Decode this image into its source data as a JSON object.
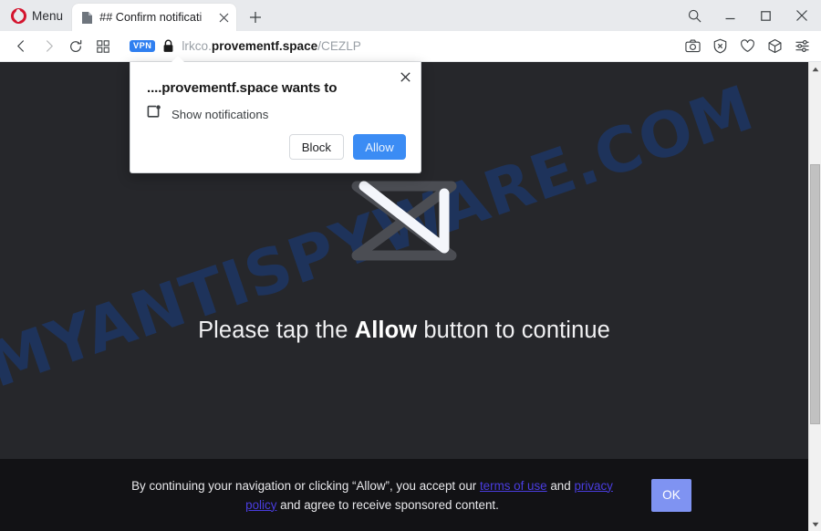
{
  "browser": {
    "menu_label": "Menu",
    "tab": {
      "title": "## Confirm notificati",
      "favicon_name": "page-favicon",
      "close_label": "×"
    },
    "new_tab_label": "+",
    "window_controls": {
      "search": "search-icon",
      "minimize": "minimize-icon",
      "maximize": "maximize-icon",
      "close": "close-icon"
    },
    "nav": {
      "back": "back-arrow-icon",
      "forward": "forward-arrow-icon",
      "reload": "reload-icon",
      "tab_gallery": "tab-gallery-icon"
    },
    "address": {
      "vpn_badge": "VPN",
      "lock_icon": "padlock-icon",
      "url_prefix": "lrkco.",
      "url_domain": "provementf.space",
      "url_path": "/CEZLP"
    },
    "toolbar_icons": [
      {
        "name": "snapshot-icon",
        "label": "Snapshot"
      },
      {
        "name": "ad-blocker-icon",
        "label": "Ad blocker"
      },
      {
        "name": "heart-icon",
        "label": "Add to favorites"
      },
      {
        "name": "crypto-wallet-icon",
        "label": "Crypto Wallet"
      },
      {
        "name": "easy-setup-icon",
        "label": "Easy setup"
      }
    ]
  },
  "permission_dialog": {
    "title": "....provementf.space wants to",
    "permission_icon": "notification-bell-icon",
    "permission_label": "Show notifications",
    "block_label": "Block",
    "allow_label": "Allow",
    "close_label": "×"
  },
  "page": {
    "watermark": "MYANTISPYWARE.COM",
    "spinner_name": "loading-spinner",
    "tagline_before": "Please tap the ",
    "tagline_emphasis": "Allow",
    "tagline_after": " button to continue",
    "banner": {
      "text_part_1": "By continuing your navigation or clicking “Allow”, you accept our ",
      "link_terms": "terms of use",
      "text_part_2": " and ",
      "link_privacy": "privacy policy",
      "text_part_3": " and agree to receive sponsored content.",
      "ok_label": "OK"
    }
  },
  "scrollbar": {
    "up_arrow": "scroll-up-arrow",
    "down_arrow": "scroll-down-arrow",
    "thumb": "scroll-thumb"
  },
  "colors": {
    "page_bg": "#26272b",
    "banner_bg": "#121215",
    "allow_blue": "#3b8cf4",
    "ok_blue": "#7f93f2",
    "link_purple": "#4a3de0",
    "watermark_blue": "#1b3a73",
    "opera_red": "#d4142e",
    "vpn_blue": "#2f7ff0"
  }
}
